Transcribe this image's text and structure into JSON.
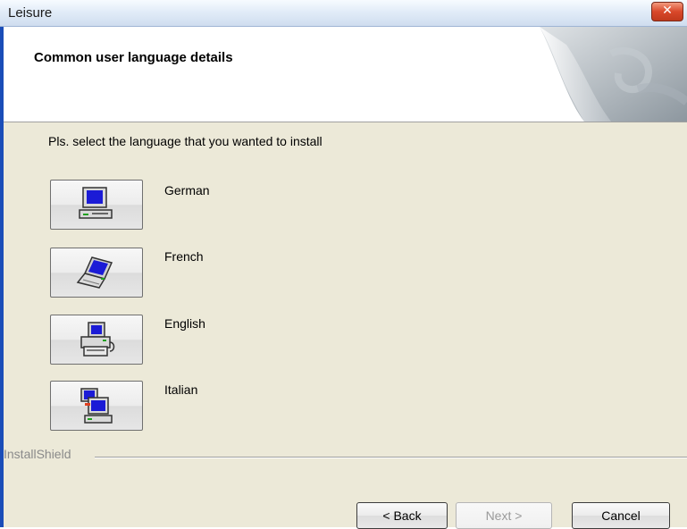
{
  "window": {
    "title": "Leisure",
    "close_glyph": "✕"
  },
  "header": {
    "title": "Common user language details"
  },
  "prompt": "Pls. select the language that you wanted to install",
  "languages": [
    {
      "label": "German",
      "icon": "desktop-computer-icon"
    },
    {
      "label": "French",
      "icon": "laptop-icon"
    },
    {
      "label": "English",
      "icon": "printer-icon"
    },
    {
      "label": "Italian",
      "icon": "network-computer-icon"
    }
  ],
  "footer": {
    "brand": "InstallShield",
    "back_label": "< Back",
    "next_label": "Next >",
    "cancel_label": "Cancel"
  }
}
